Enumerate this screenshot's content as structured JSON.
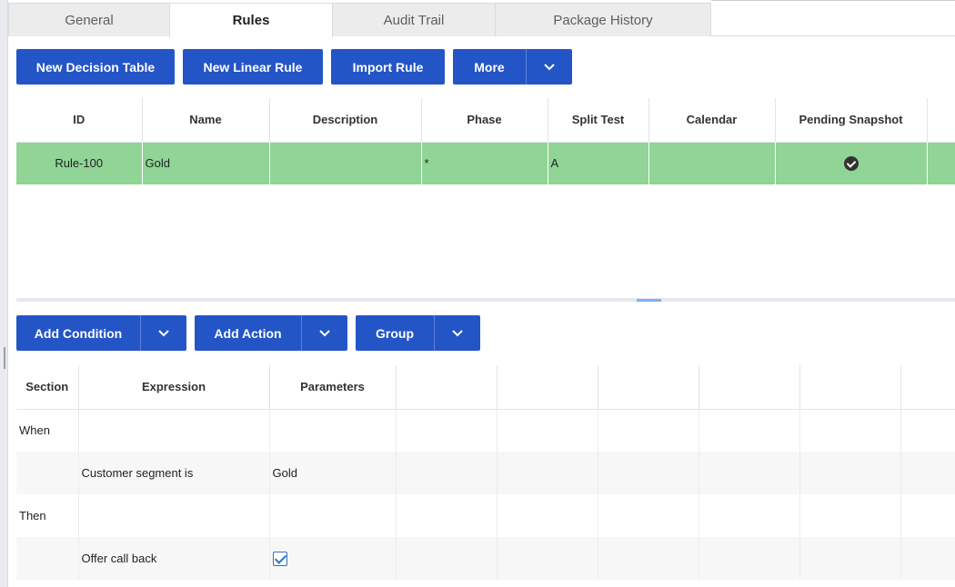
{
  "tabs": [
    {
      "label": "General"
    },
    {
      "label": "Rules"
    },
    {
      "label": "Audit Trail"
    },
    {
      "label": "Package History"
    }
  ],
  "toolbar": {
    "new_decision_table": "New Decision Table",
    "new_linear_rule": "New Linear Rule",
    "import_rule": "Import Rule",
    "more": "More"
  },
  "rules_table": {
    "columns": [
      "ID",
      "Name",
      "Description",
      "Phase",
      "Split Test",
      "Calendar",
      "Pending Snapshot"
    ],
    "rows": [
      {
        "id": "Rule-100",
        "name": "Gold",
        "description": "",
        "phase": "*",
        "split_test": "A",
        "calendar": "",
        "pending_snapshot": "check-circle-icon"
      }
    ]
  },
  "rule_toolbar": {
    "add_condition": "Add Condition",
    "add_action": "Add Action",
    "group": "Group"
  },
  "conditions_table": {
    "columns": [
      "Section",
      "Expression",
      "Parameters"
    ],
    "rows": [
      {
        "section": "When",
        "expression": "",
        "parameters": ""
      },
      {
        "section": "",
        "expression": "Customer segment is",
        "parameters": "Gold"
      },
      {
        "section": "Then",
        "expression": "",
        "parameters": ""
      },
      {
        "section": "",
        "expression": "Offer call back",
        "parameters": "checkbox-checked-icon"
      }
    ]
  },
  "colors": {
    "primary_button": "#2455c7",
    "selected_row": "#90d595"
  }
}
